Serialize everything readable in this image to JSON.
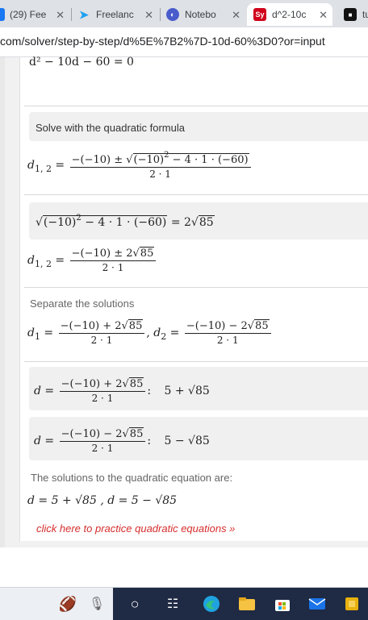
{
  "browser": {
    "tabs": [
      {
        "favicon_text": "",
        "label": "(29) Fee",
        "color": "#1877f2"
      },
      {
        "favicon_text": "",
        "label": "Freelanc",
        "color": "#1da1f2"
      },
      {
        "favicon_text": "",
        "label": "Notebo",
        "color": "#4a5ccc"
      },
      {
        "favicon_text": "Sy",
        "label": "d^2-10c",
        "color": "#d0021b"
      },
      {
        "favicon_text": "",
        "label": "tu",
        "color": "#111111"
      }
    ],
    "close_glyph": "✕",
    "url_host": "com/solver/step-by-step/d%5E%7B2%7D-10d-60%3D0?or=input"
  },
  "solution": {
    "equation_top": "d² − 10d − 60 = 0",
    "step_quadratic_label": "Solve with the quadratic formula",
    "separate_label": "Separate the solutions",
    "solutions_intro": "The solutions to the quadratic equation are:",
    "practice_link": "click here to practice quadratic equations »",
    "results": {
      "plus": "5 + √85",
      "minus": "5 − √85",
      "final": "d = 5 + √85 , d = 5 − √85"
    }
  },
  "colors": {
    "link": "#d62d2d",
    "gray_box": "#f0f0f0"
  },
  "taskbar": {
    "icons": [
      "sports-widget-icon",
      "microphone-icon",
      "search-circle-icon",
      "task-view-icon",
      "edge-browser-icon",
      "file-explorer-icon",
      "microsoft-store-icon",
      "mail-icon",
      "office-icon"
    ]
  }
}
